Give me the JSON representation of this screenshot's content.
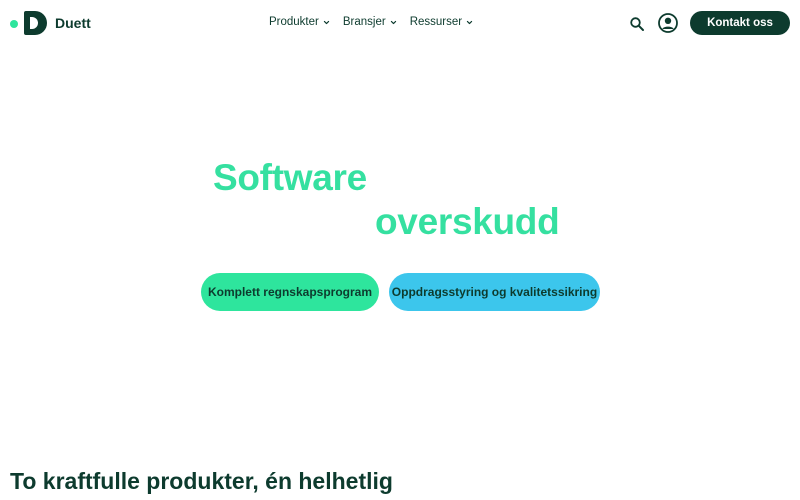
{
  "header": {
    "logo_text": "Duett",
    "nav": [
      {
        "label": "Produkter"
      },
      {
        "label": "Bransjer"
      },
      {
        "label": "Ressurser"
      }
    ],
    "cta_label": "Kontakt oss"
  },
  "hero": {
    "line1": "Software",
    "line2": "overskudd",
    "buttons": [
      {
        "label": "Komplett regnskapsprogram"
      },
      {
        "label": "Oppdragsstyring og kvalitetssikring"
      }
    ]
  },
  "section": {
    "heading": "To kraftfulle produkter, én helhetlig"
  },
  "colors": {
    "brand_dark": "#0d3b2e",
    "accent_green": "#2ee59d",
    "hero_text_green": "#35e0a0",
    "accent_blue": "#3cc6ec"
  },
  "icons": {
    "logo": "duett-logo-icon",
    "search": "search-icon",
    "user": "user-account-icon",
    "chevron": "chevron-down-icon"
  }
}
